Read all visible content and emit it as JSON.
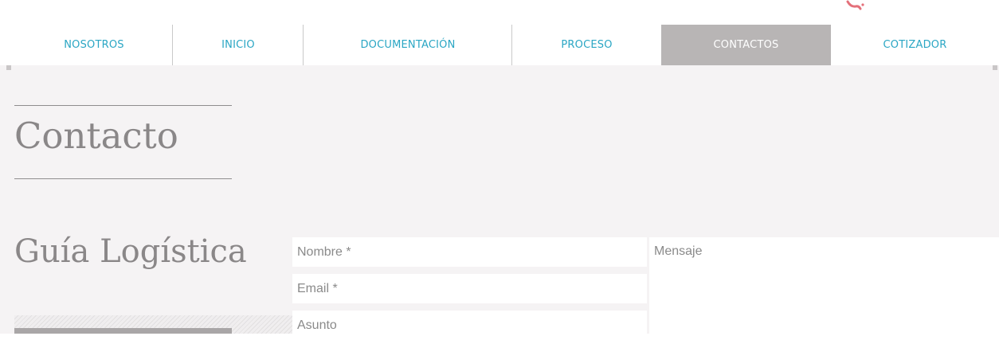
{
  "nav": {
    "items": [
      {
        "label": "NOSOTROS",
        "active": false
      },
      {
        "label": "INICIO",
        "active": false
      },
      {
        "label": "DOCUMENTACIÓN",
        "active": false
      },
      {
        "label": "PROCESO",
        "active": false
      },
      {
        "label": "CONTACTOS",
        "active": true
      },
      {
        "label": "COTIZADOR",
        "active": false
      }
    ]
  },
  "page": {
    "title": "Contacto"
  },
  "section": {
    "title": "Guía Logística"
  },
  "form": {
    "name_placeholder": "Nombre *",
    "email_placeholder": "Email *",
    "subject_placeholder": "Asunto",
    "message_placeholder": "Mensaje"
  },
  "colors": {
    "accent": "#2aa6c4",
    "active_tab": "#b8b5b5",
    "panel_background": "#f5f3f4",
    "heading_text": "#8a8788"
  }
}
